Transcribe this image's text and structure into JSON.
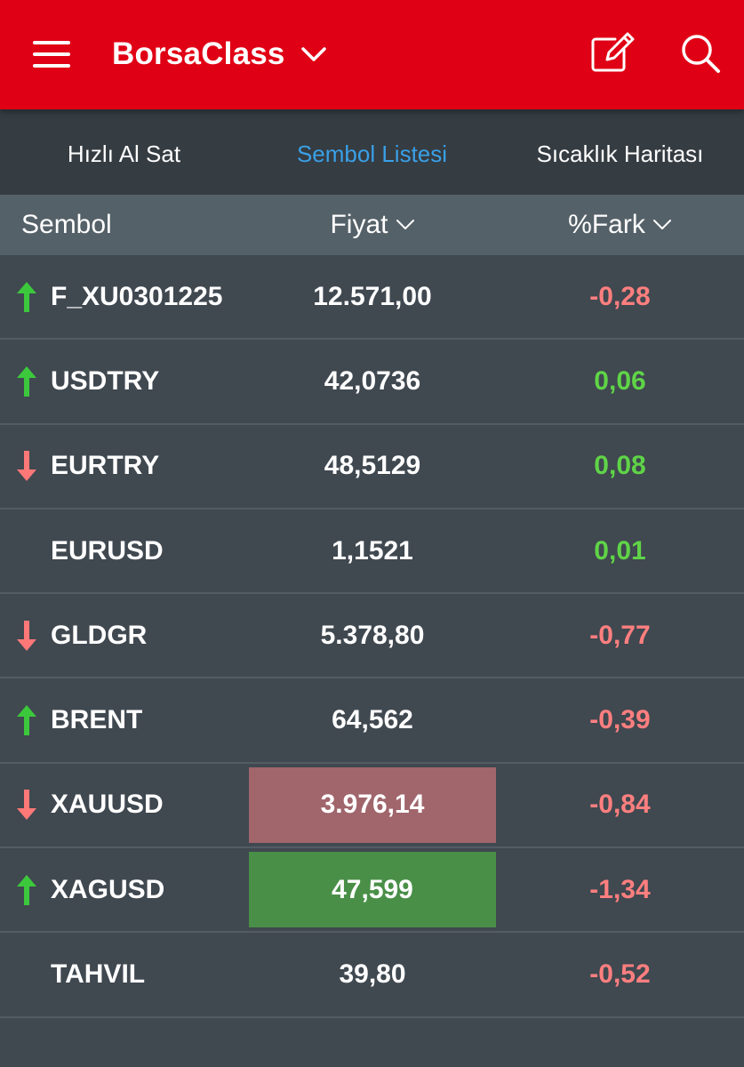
{
  "header": {
    "title": "BorsaClass",
    "menu_icon": "hamburger-menu-icon",
    "dropdown_icon": "chevron-down-icon",
    "edit_icon": "edit-icon",
    "search_icon": "search-icon",
    "background_color": "#e00015"
  },
  "tabs": [
    {
      "label": "Hızlı Al Sat",
      "active": false
    },
    {
      "label": "Sembol Listesi",
      "active": true
    },
    {
      "label": "Sıcaklık Haritası",
      "active": false
    }
  ],
  "columns": {
    "symbol": "Sembol",
    "price": "Fiyat",
    "change": "%Fark"
  },
  "colors": {
    "up_arrow": "#3cc83c",
    "down_arrow": "#ff7878",
    "positive": "#5fd447",
    "negative": "#ff7f7f",
    "price_up_highlight": "#4a8f48",
    "price_down_highlight": "#a0666c",
    "active_tab": "#3aa0e6"
  },
  "rows": [
    {
      "symbol": "F_XU0301225",
      "price": "12.571,00",
      "change": "-0,28",
      "arrow": "up",
      "change_sign": "negative",
      "highlight": "none"
    },
    {
      "symbol": "USDTRY",
      "price": "42,0736",
      "change": "0,06",
      "arrow": "up",
      "change_sign": "positive",
      "highlight": "none"
    },
    {
      "symbol": "EURTRY",
      "price": "48,5129",
      "change": "0,08",
      "arrow": "down",
      "change_sign": "positive",
      "highlight": "none"
    },
    {
      "symbol": "EURUSD",
      "price": "1,1521",
      "change": "0,01",
      "arrow": "none",
      "change_sign": "positive",
      "highlight": "none"
    },
    {
      "symbol": "GLDGR",
      "price": "5.378,80",
      "change": "-0,77",
      "arrow": "down",
      "change_sign": "negative",
      "highlight": "none"
    },
    {
      "symbol": "BRENT",
      "price": "64,562",
      "change": "-0,39",
      "arrow": "up",
      "change_sign": "negative",
      "highlight": "none"
    },
    {
      "symbol": "XAUUSD",
      "price": "3.976,14",
      "change": "-0,84",
      "arrow": "down",
      "change_sign": "negative",
      "highlight": "down"
    },
    {
      "symbol": "XAGUSD",
      "price": "47,599",
      "change": "-1,34",
      "arrow": "up",
      "change_sign": "negative",
      "highlight": "up"
    },
    {
      "symbol": "TAHVIL",
      "price": "39,80",
      "change": "-0,52",
      "arrow": "none",
      "change_sign": "negative",
      "highlight": "none"
    }
  ]
}
